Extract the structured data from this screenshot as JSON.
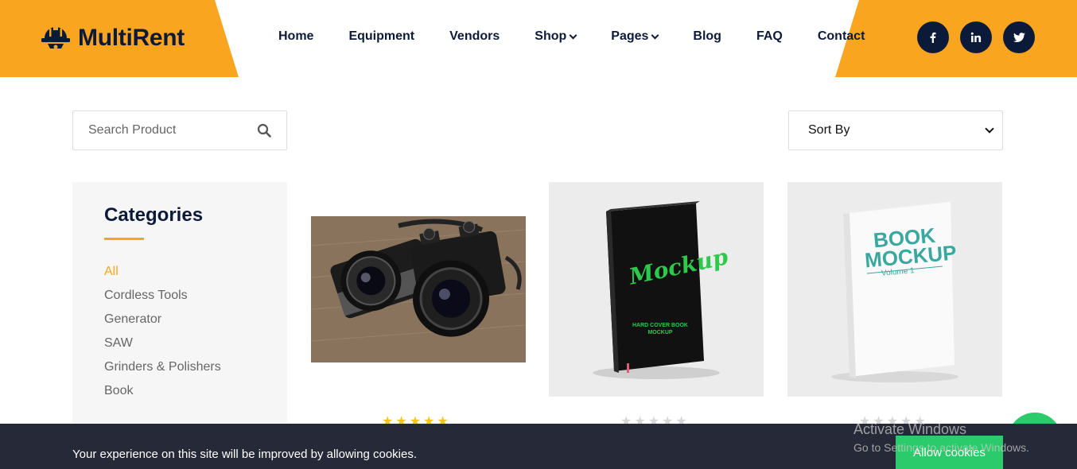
{
  "brand": {
    "name": "MultiRent",
    "logo_icon": "helmet-gear-icon",
    "accent": "#f9a51f",
    "dark": "#0c1a3a"
  },
  "nav": {
    "items": [
      {
        "label": "Home",
        "dropdown": false
      },
      {
        "label": "Equipment",
        "dropdown": false
      },
      {
        "label": "Vendors",
        "dropdown": false
      },
      {
        "label": "Shop",
        "dropdown": true
      },
      {
        "label": "Pages",
        "dropdown": true
      },
      {
        "label": "Blog",
        "dropdown": false
      },
      {
        "label": "FAQ",
        "dropdown": false
      },
      {
        "label": "Contact",
        "dropdown": false
      }
    ]
  },
  "social": [
    {
      "icon": "facebook-icon",
      "glyph": "f"
    },
    {
      "icon": "linkedin-icon",
      "glyph": "in"
    },
    {
      "icon": "twitter-icon",
      "glyph": "t"
    }
  ],
  "search": {
    "placeholder": "Search Product",
    "value": ""
  },
  "sort": {
    "selected": "Sort By"
  },
  "categories": {
    "title": "Categories",
    "items": [
      "All",
      "Cordless Tools",
      "Generator",
      "SAW",
      "Grinders & Polishers",
      "Book"
    ],
    "active": "All"
  },
  "products": [
    {
      "image": "cameras-photo",
      "rating": 5,
      "rating_max": 5
    },
    {
      "image": "black-hardcover-book-mockup",
      "cover_title": "Mockup",
      "cover_sub": "HARD COVER BOOK MOCKUP",
      "rating": 0,
      "rating_max": 5
    },
    {
      "image": "white-book-mockup",
      "cover_title": "BOOK MOCKUP",
      "cover_sub": "Volume 1",
      "rating": 0,
      "rating_max": 5
    }
  ],
  "cookie": {
    "text": "Your experience on this site will be improved by allowing cookies.",
    "button": "Allow cookies"
  },
  "watermark": {
    "title": "Activate Windows",
    "sub": "Go to Settings to activate Windows."
  }
}
